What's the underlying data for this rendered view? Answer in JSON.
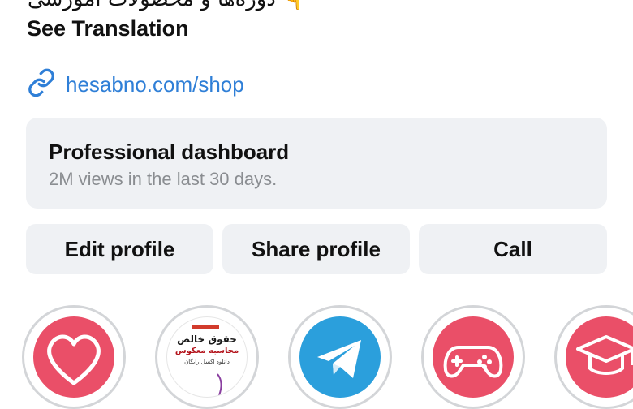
{
  "bio": {
    "line_fragment": "دوره‌ها و محصولات آموزشی",
    "emoji": "👇",
    "see_translation": "See Translation"
  },
  "link": {
    "icon": "link-icon",
    "text": "hesabno.com/shop",
    "color": "#2f7fd7"
  },
  "dashboard": {
    "title": "Professional dashboard",
    "subtitle": "2M views in the last 30 days."
  },
  "buttons": {
    "edit": "Edit profile",
    "share": "Share profile",
    "call": "Call"
  },
  "highlights": [
    {
      "icon": "heart-icon",
      "color": "#ea4f68"
    },
    {
      "icon": "promo-thumbnail",
      "text_lines": [
        "حقوق خالص",
        "محاسبه معکوس",
        "دانلود اکسل رایگان"
      ]
    },
    {
      "icon": "telegram-icon",
      "color": "#2b9fdc"
    },
    {
      "icon": "gamepad-icon",
      "color": "#ea4f68"
    },
    {
      "icon": "graduation-cap-icon",
      "color": "#ea4f68"
    }
  ]
}
